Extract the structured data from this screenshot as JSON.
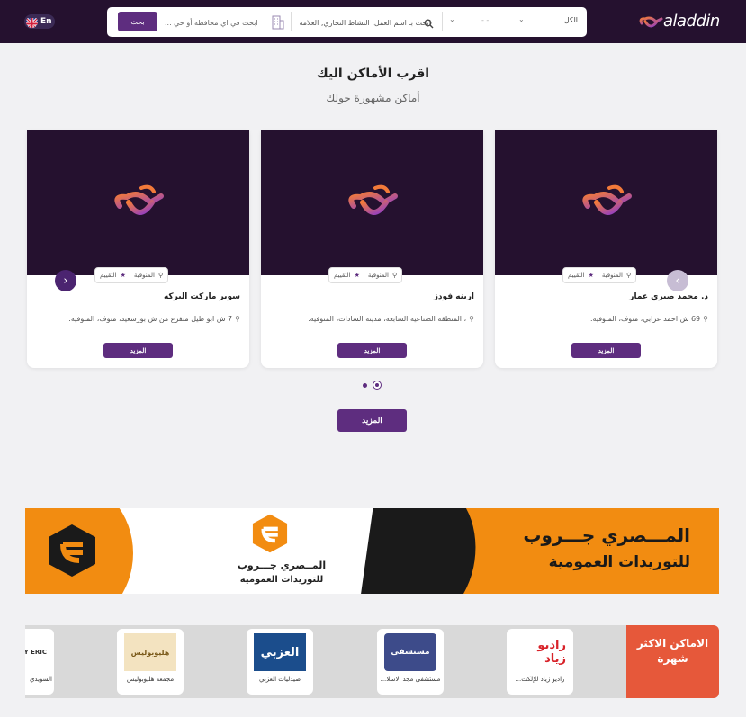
{
  "header": {
    "language_label": "En",
    "brand_name": "aladdin",
    "search": {
      "button_label": "بحث",
      "location_placeholder": "ابحث في اي محافظة أو حي ...",
      "keyword_placeholder": "ابحث بـ اسم العمل, النشاط التجاري, العلامة",
      "city_value": "- -",
      "category_value": "الكل"
    }
  },
  "section": {
    "title": "اقرب الأماكن اليك",
    "subtitle": "أماكن مشهورة حولك"
  },
  "cards": [
    {
      "name": "سوبر ماركت البركه",
      "address": "7 ش ابو طيل متفرع من ش بورسعيد، منوف، المنوفية.",
      "tag_region": "المنوفية",
      "tag_rating": "التقييم",
      "more_label": "المزيد"
    },
    {
      "name": "ارينه فودز",
      "address": "، المنطقة الصناعية السابعة، مدينة السادات، المنوفية.",
      "tag_region": "المنوفية",
      "tag_rating": "التقييم",
      "more_label": "المزيد"
    },
    {
      "name": "د. محمد صبري عمار",
      "address": "69 ش احمد عرابي، منوف، المنوفية.",
      "tag_region": "المنوفية",
      "tag_rating": "التقييم",
      "more_label": "المزيد"
    }
  ],
  "carousel": {
    "prev_icon": "chevron-left-icon",
    "next_icon": "chevron-right-icon",
    "active_dot": 1,
    "dot_count": 2
  },
  "more_button_label": "المزيد",
  "banner": {
    "title_line1": "المـــصري جـــروب",
    "title_line2": "للتوريدات العمومية",
    "center_line1": "المــصري جـــروب",
    "center_line2": "للتوريدات العمومية"
  },
  "popular": {
    "title": "الاماكن الاكثر شهرة",
    "items": [
      {
        "name": "راديو زياد للإلكت...",
        "logo_text": "راديو زياد"
      },
      {
        "name": "مستشفى مجد الاسلا...",
        "logo_text": "مستشفى"
      },
      {
        "name": "صيدليات العزبي",
        "logo_text": "العزبي"
      },
      {
        "name": "مجمعه هليوبوليس",
        "logo_text": "هليوبوليس"
      },
      {
        "name": "السويدي",
        "logo_text": "EDY ERIC"
      }
    ]
  },
  "colors": {
    "header_bg": "#25112f",
    "accent_purple": "#5e2d7f",
    "banner_orange": "#f28c11",
    "popular_red": "#e6583a"
  }
}
